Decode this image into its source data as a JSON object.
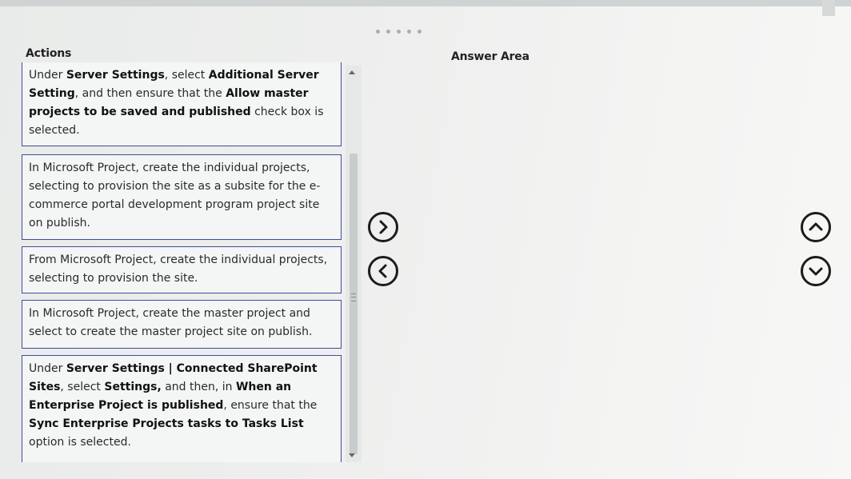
{
  "pager": {
    "dots": 5
  },
  "actions": {
    "heading": "Actions",
    "items": [
      {
        "parts": [
          {
            "t": "Under ",
            "b": false
          },
          {
            "t": "Server Settings",
            "b": true
          },
          {
            "t": ", select ",
            "b": false
          },
          {
            "t": "Additional Server Setting",
            "b": true
          },
          {
            "t": ", and then ensure that the ",
            "b": false
          },
          {
            "t": "Allow master projects to be saved and published",
            "b": true
          },
          {
            "t": " check box is selected.",
            "b": false
          }
        ]
      },
      {
        "parts": [
          {
            "t": "In Microsoft Project, create the individual projects, selecting to provision the site as a subsite for the e-commerce portal development program project site on publish.",
            "b": false
          }
        ]
      },
      {
        "parts": [
          {
            "t": "From Microsoft Project, create the individual projects, selecting to provision the site.",
            "b": false
          }
        ]
      },
      {
        "parts": [
          {
            "t": "In Microsoft Project, create the master project and select to create the master project site on publish.",
            "b": false
          }
        ]
      },
      {
        "parts": [
          {
            "t": "Under ",
            "b": false
          },
          {
            "t": "Server Settings | Connected SharePoint Sites",
            "b": true
          },
          {
            "t": ", select ",
            "b": false
          },
          {
            "t": "Settings,",
            "b": true
          },
          {
            "t": " and then, in ",
            "b": false
          },
          {
            "t": "When an Enterprise Project is published",
            "b": true
          },
          {
            "t": ", ensure that the ",
            "b": false
          },
          {
            "t": "Sync Enterprise Projects tasks to Tasks List",
            "b": true
          },
          {
            "t": " option is selected.",
            "b": false
          }
        ]
      }
    ]
  },
  "answer_area": {
    "heading": "Answer Area",
    "items": []
  },
  "controls": {
    "move_right_icon": "chevron-right-circle-icon",
    "move_left_icon": "chevron-left-circle-icon",
    "move_up_icon": "chevron-up-circle-icon",
    "move_down_icon": "chevron-down-circle-icon"
  },
  "colors": {
    "card_border": "#3c4d9a",
    "button_stroke": "#1c1c1c"
  }
}
